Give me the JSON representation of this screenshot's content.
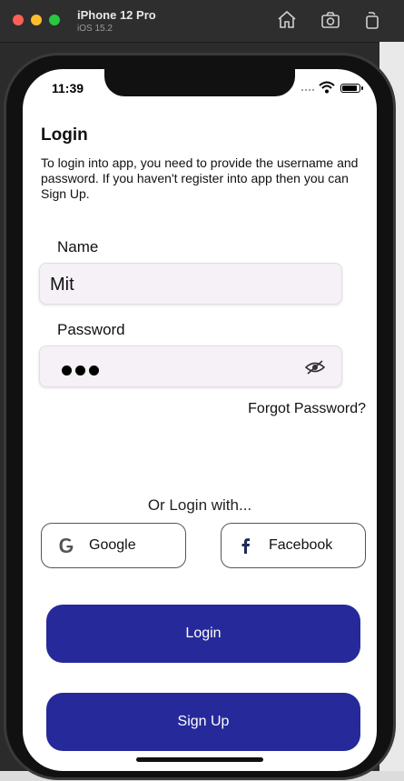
{
  "simulator": {
    "device_name": "iPhone 12 Pro",
    "os_version": "iOS 15.2"
  },
  "status_bar": {
    "time": "11:39",
    "battery_level": 0.9
  },
  "login_screen": {
    "title": "Login",
    "description": "To login into app, you need to provide the username and password. If you haven't register into app then you can Sign Up.",
    "name_label": "Name",
    "name_value": "Mit",
    "password_label": "Password",
    "password_mask_count": 3,
    "forgot_password": "Forgot Password?",
    "or_login_with": "Or Login with...",
    "social": [
      {
        "label": "Google",
        "icon": "google-icon"
      },
      {
        "label": "Facebook",
        "icon": "facebook-icon"
      }
    ],
    "login_button": "Login",
    "signup_button": "Sign Up"
  },
  "colors": {
    "primary_button": "#26299a",
    "input_background": "#f5f1f6"
  }
}
